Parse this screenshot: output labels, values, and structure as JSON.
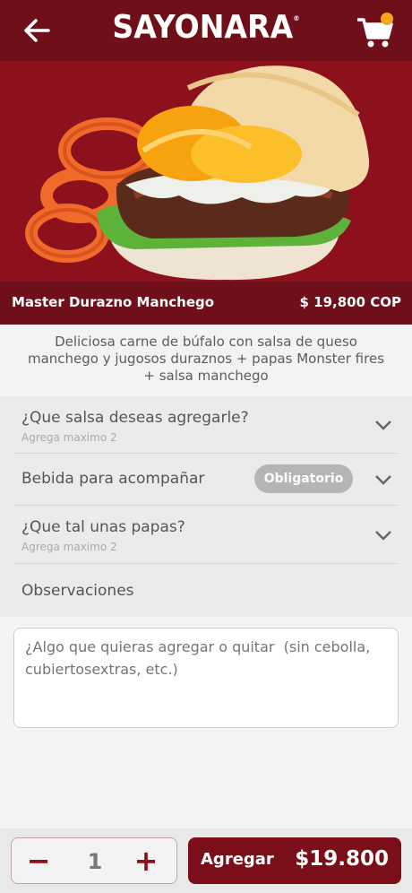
{
  "header": {
    "logo": "SAYONARA",
    "logo_mark": "®"
  },
  "product": {
    "name": "Master Durazno Manchego",
    "price": "$ 19,800 COP",
    "description": "Deliciosa carne de búfalo con salsa de queso manchego y jugosos duraznos + papas Monster fires + salsa manchego"
  },
  "options": [
    {
      "title": "¿Que salsa deseas agregarle?",
      "subtitle": "Agrega maximo 2"
    },
    {
      "title": "Bebida para acompañar",
      "badge": "Obligatorio"
    },
    {
      "title": "¿Que tal unas papas?",
      "subtitle": "Agrega maximo 2"
    },
    {
      "title": "Observaciones"
    }
  ],
  "notes": {
    "placeholder": "¿Algo que quieras agregar o quitar  (sin cebolla, cubiertosextras, etc.)"
  },
  "order": {
    "minus": "−",
    "quantity": "1",
    "plus": "+",
    "add_label": "Agregar",
    "total": "$19.800"
  },
  "colors": {
    "brand_dark": "#6e0f19",
    "brand": "#8c111c",
    "cart_badge": "#f6a51c",
    "badge_gray": "#b5b5b5"
  },
  "icons": {
    "back": "back-arrow-icon",
    "cart": "shopping-cart-icon",
    "chevron": "chevron-down-icon"
  }
}
